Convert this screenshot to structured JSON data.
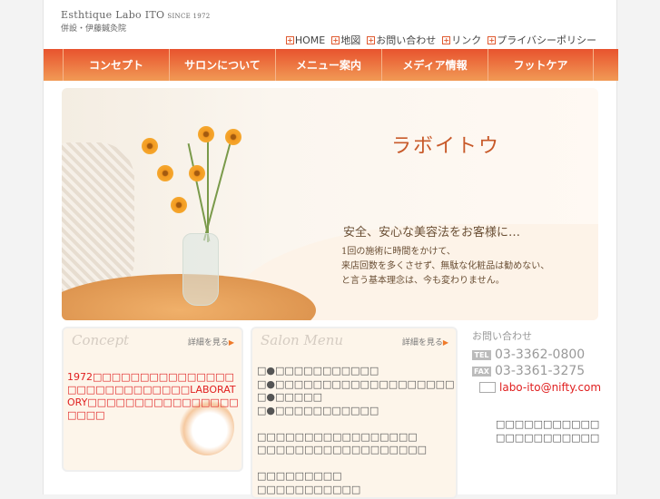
{
  "logo": {
    "name": "Esthtique Labo ITO",
    "since": "SINCE 1972",
    "sub": "併設・伊藤鍼灸院"
  },
  "topnav": [
    "HOME",
    "地図",
    "お問い合わせ",
    "リンク",
    "プライバシーポリシー"
  ],
  "mainnav": [
    "コンセプト",
    "サロンについて",
    "メニュー案内",
    "メディア情報",
    "フットケア"
  ],
  "hero": {
    "title": "ラボイトウ",
    "subtitle": "安全、安心な美容法をお客様に…",
    "body": [
      "1回の施術に時間をかけて、",
      "来店回数を多くさせず、無駄な化粧品は勧めない、",
      "と言う基本理念は、今も変わりません。"
    ]
  },
  "concept": {
    "heading": "Concept",
    "more": "詳細を見る",
    "text": "1972□□□□□□□□□□□□□□□□□□□□□□□□□□□□LABORATORY□□□□□□□□□□□□□□□□□□□□"
  },
  "menu": {
    "heading": "Salon Menu",
    "more": "詳細を見る",
    "lines": [
      "□●□□□□□□□□□□□",
      "□●□□□□□□□□□□□□□□□□□□□",
      "□●□□□□□",
      "□●□□□□□□□□□□□",
      "",
      "□□□□□□□□□□□□□□□□□",
      "□□□□□□□□□□□□□□□□□□",
      "",
      "□□□□□□□□□",
      "□□□□□□□□□□□"
    ]
  },
  "contact": {
    "label": "お問い合わせ",
    "tel_badge": "TEL",
    "tel": "03-3362-0800",
    "fax_badge": "FAX",
    "fax": "03-3361-3275",
    "email": "labo-ito@nifty.com",
    "address": [
      "□□□□□□□□□□□",
      "□□□□□□□□□□□"
    ]
  }
}
